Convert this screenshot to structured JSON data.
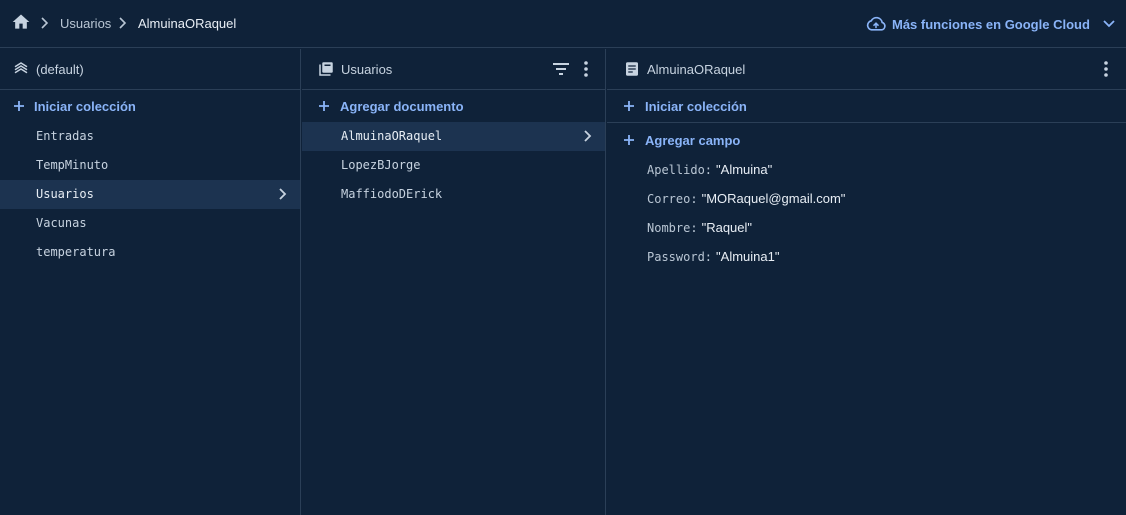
{
  "breadcrumb": {
    "items": [
      "Usuarios",
      "AlmuinaORaquel"
    ]
  },
  "cloud": {
    "label": "Más funciones en Google Cloud"
  },
  "colors": {
    "background": "#0f2239",
    "accent": "#8ab4f8",
    "selected": "#1c3350",
    "border": "#2b3f57"
  },
  "root_panel": {
    "title": "(default)",
    "action": "Iniciar colección",
    "collections": [
      "Entradas",
      "TempMinuto",
      "Usuarios",
      "Vacunas",
      "temperatura"
    ],
    "selected": "Usuarios"
  },
  "collection_panel": {
    "title": "Usuarios",
    "action": "Agregar documento",
    "documents": [
      "AlmuinaORaquel",
      "LopezBJorge",
      "MaffiodoDErick"
    ],
    "selected": "AlmuinaORaquel"
  },
  "document_panel": {
    "title": "AlmuinaORaquel",
    "start_collection": "Iniciar colección",
    "add_field": "Agregar campo",
    "fields": [
      {
        "key": "Apellido",
        "value": "\"Almuina\""
      },
      {
        "key": "Correo",
        "value": "\"MORaquel@gmail.com\""
      },
      {
        "key": "Nombre",
        "value": "\"Raquel\""
      },
      {
        "key": "Password",
        "value": "\"Almuina1\""
      }
    ]
  },
  "icons": {
    "home": "home-icon",
    "cloud": "cloud-icon",
    "database": "database-icon",
    "collection": "collection-icon",
    "document": "document-icon",
    "filter": "filter-icon",
    "more": "more-vert-icon",
    "plus": "plus-icon",
    "chevron": "chevron-right-icon"
  }
}
